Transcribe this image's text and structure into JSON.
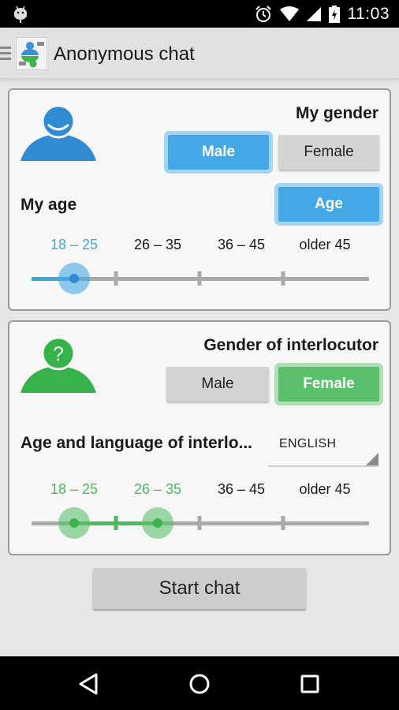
{
  "status_bar": {
    "time": "11:03",
    "icons": [
      "android-debug-icon",
      "alarm-icon",
      "wifi-icon",
      "cell-signal-icon",
      "battery-charging-icon"
    ]
  },
  "action_bar": {
    "title": "Anonymous chat",
    "menu_icon": "hamburger-menu-icon",
    "logo_icon": "app-logo-icon"
  },
  "my_section": {
    "avatar_icon": "smiling-user-icon",
    "gender_heading": "My gender",
    "gender_options": [
      {
        "label": "Male",
        "selected": true
      },
      {
        "label": "Female",
        "selected": false
      }
    ],
    "age_label": "My age",
    "age_button": "Age",
    "age_ranges": [
      "18 – 25",
      "26 – 35",
      "36 – 45",
      "older 45"
    ],
    "age_selected_index": 0,
    "accent_color": "#45a8e6"
  },
  "interlocutor_section": {
    "avatar_icon": "unknown-user-icon",
    "avatar_glyph": "?",
    "gender_heading": "Gender of interlocutor",
    "gender_options": [
      {
        "label": "Male",
        "selected": false
      },
      {
        "label": "Female",
        "selected": true
      }
    ],
    "age_lang_label": "Age and language of interlo...",
    "language": "ENGLISH",
    "age_ranges": [
      "18 – 25",
      "26 – 35",
      "36 – 45",
      "older 45"
    ],
    "age_selected_range": [
      0,
      1
    ],
    "accent_color": "#5bbf6c"
  },
  "start_button": "Start chat",
  "nav_bar": {
    "back": "back-icon",
    "home": "home-icon",
    "recents": "recents-icon"
  }
}
